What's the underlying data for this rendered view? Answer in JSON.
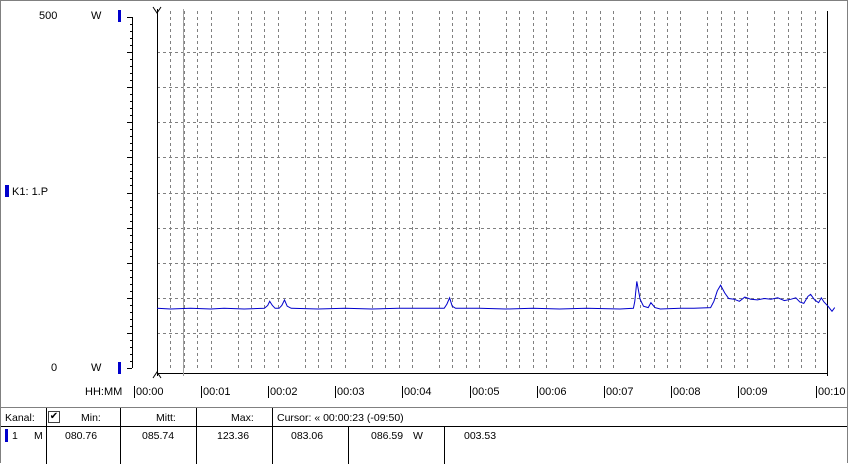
{
  "axis": {
    "y_max": "500",
    "y_min": "0",
    "y_unit": "W",
    "time_label": "HH:MM",
    "time_ticks": [
      "00:00",
      "00:01",
      "00:02",
      "00:03",
      "00:04",
      "00:05",
      "00:06",
      "00:07",
      "00:08",
      "00:09",
      "00:10"
    ]
  },
  "legend": {
    "channel_label": "K1: 1.P",
    "color": "#0000cc"
  },
  "chart_data": {
    "type": "line",
    "ylim": [
      0,
      500
    ],
    "xlim": [
      0,
      10
    ],
    "x_unit": "minutes",
    "grid": true,
    "series": [
      {
        "color": "#0000cc",
        "points": [
          [
            0.0,
            85
          ],
          [
            0.2,
            84
          ],
          [
            0.5,
            85
          ],
          [
            0.8,
            84
          ],
          [
            1.0,
            85
          ],
          [
            1.3,
            84
          ],
          [
            1.6,
            85
          ],
          [
            1.65,
            89
          ],
          [
            1.68,
            95
          ],
          [
            1.72,
            89
          ],
          [
            1.76,
            85
          ],
          [
            1.82,
            85
          ],
          [
            1.86,
            89
          ],
          [
            1.9,
            97
          ],
          [
            1.94,
            88
          ],
          [
            2.0,
            85
          ],
          [
            2.4,
            84
          ],
          [
            2.8,
            85
          ],
          [
            3.2,
            84
          ],
          [
            3.6,
            85
          ],
          [
            4.0,
            85
          ],
          [
            4.28,
            85
          ],
          [
            4.32,
            91
          ],
          [
            4.36,
            100
          ],
          [
            4.4,
            88
          ],
          [
            4.45,
            85
          ],
          [
            4.8,
            85
          ],
          [
            5.2,
            84
          ],
          [
            5.6,
            85
          ],
          [
            6.0,
            84
          ],
          [
            6.4,
            85
          ],
          [
            6.9,
            84
          ],
          [
            7.1,
            85
          ],
          [
            7.12,
            95
          ],
          [
            7.15,
            123.36
          ],
          [
            7.2,
            98
          ],
          [
            7.25,
            88
          ],
          [
            7.32,
            86
          ],
          [
            7.36,
            93
          ],
          [
            7.42,
            86
          ],
          [
            7.5,
            84
          ],
          [
            7.8,
            85
          ],
          [
            8.0,
            85
          ],
          [
            8.25,
            86
          ],
          [
            8.3,
            95
          ],
          [
            8.35,
            110
          ],
          [
            8.4,
            118
          ],
          [
            8.46,
            107
          ],
          [
            8.52,
            99
          ],
          [
            8.6,
            98
          ],
          [
            8.68,
            95
          ],
          [
            8.76,
            101
          ],
          [
            8.85,
            98
          ],
          [
            8.95,
            97
          ],
          [
            9.05,
            99
          ],
          [
            9.15,
            98
          ],
          [
            9.25,
            100
          ],
          [
            9.35,
            96
          ],
          [
            9.45,
            98
          ],
          [
            9.52,
            100
          ],
          [
            9.58,
            94
          ],
          [
            9.64,
            92
          ],
          [
            9.7,
            102
          ],
          [
            9.74,
            105
          ],
          [
            9.8,
            97
          ],
          [
            9.86,
            93
          ],
          [
            9.9,
            100
          ],
          [
            9.94,
            94
          ],
          [
            10.0,
            88
          ],
          [
            10.06,
            80.76
          ],
          [
            10.1,
            86
          ]
        ]
      }
    ],
    "cursor_minutes": 0.383
  },
  "stats": {
    "headers": {
      "kanal": "Kanal:",
      "min": "Min:",
      "mitt": "Mitt:",
      "max": "Max:",
      "cursor": "Cursor: « 00:00:23 (-09:50)",
      "checkbox": "✔"
    },
    "row": {
      "channel": "1",
      "mode": "M",
      "min": "080.76",
      "mitt": "085.74",
      "max": "123.36",
      "cursor_value": "083.06",
      "cursor_value2": "086.59",
      "unit": "W",
      "delta": "003.53"
    }
  }
}
